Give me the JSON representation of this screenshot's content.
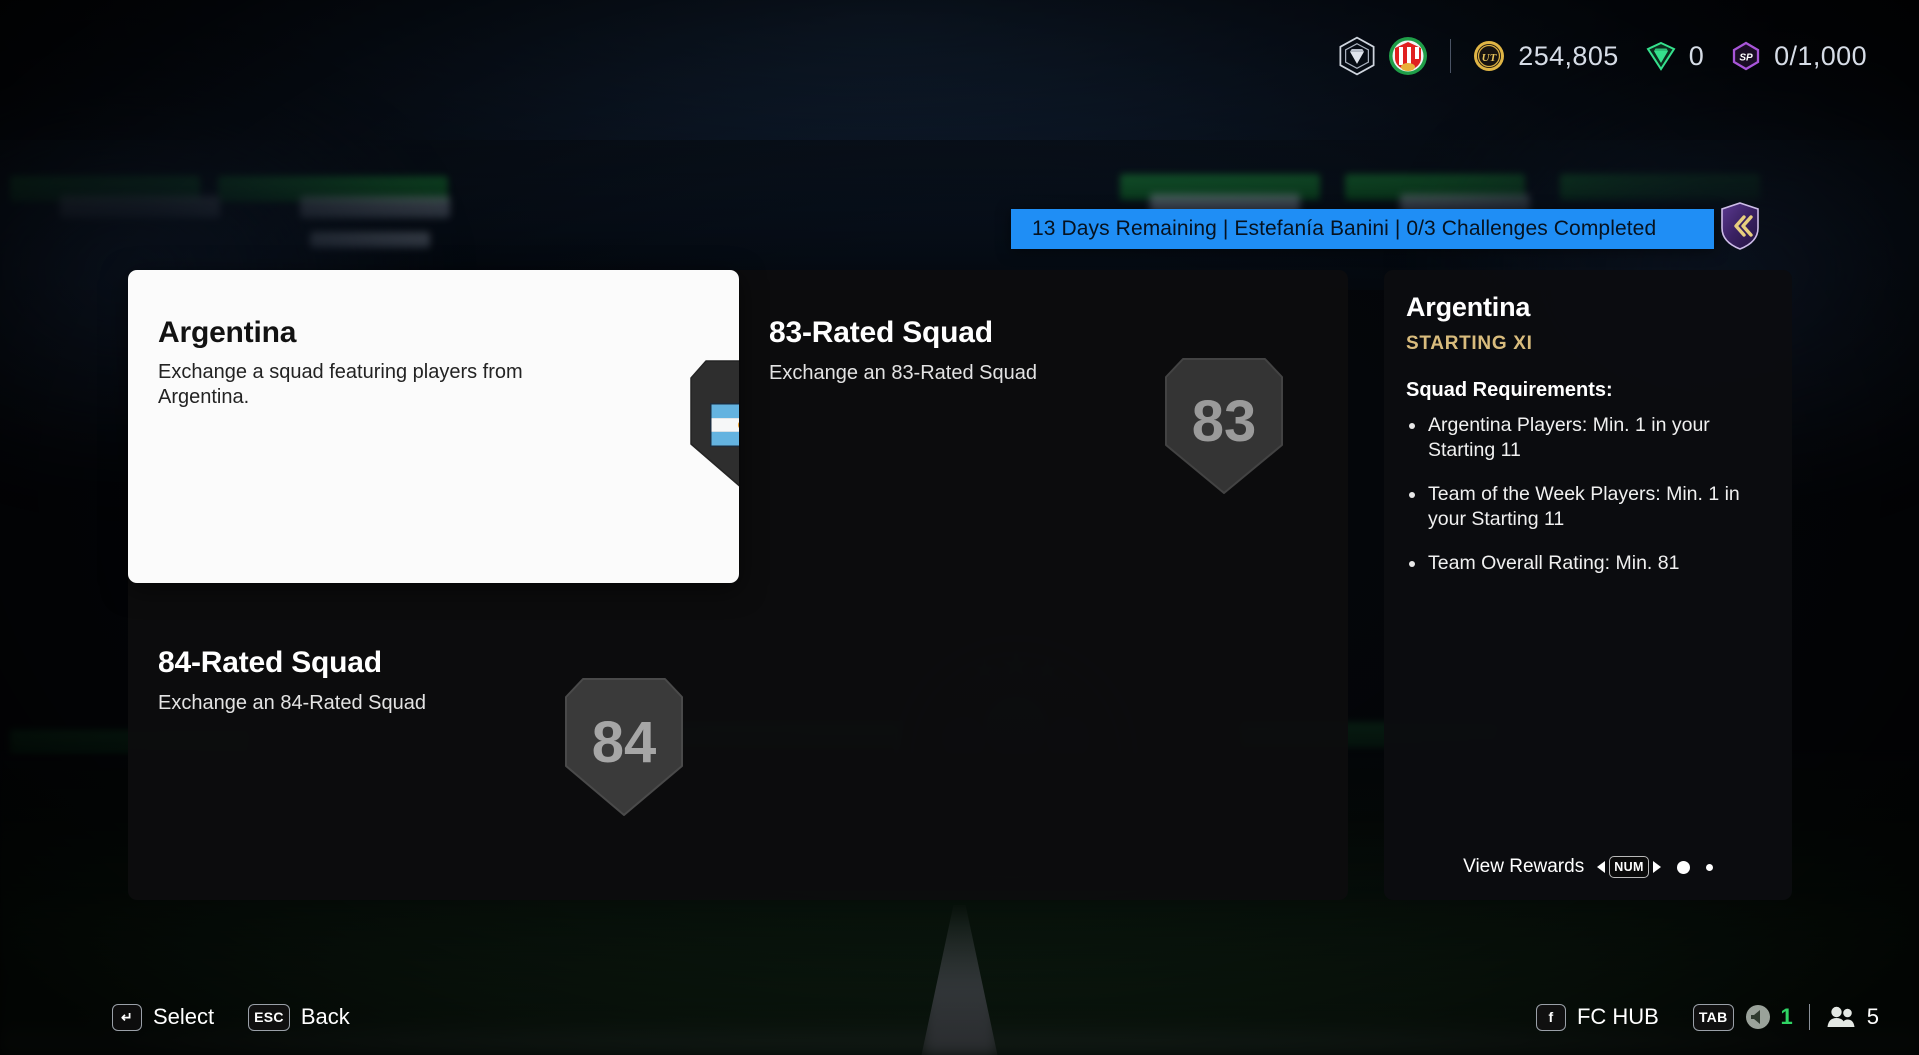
{
  "hud": {
    "crest_icon": "ultimate-team-crest-icon",
    "club_icon": "club-badge-icon",
    "coins": {
      "icon": "ut-coin-icon",
      "value": "254,805"
    },
    "points": {
      "icon": "fc-points-icon",
      "value": "0"
    },
    "season_points": {
      "icon": "sp-hex-icon",
      "value": "0/1,000"
    }
  },
  "banner": {
    "text": "13 Days Remaining | Estefanía Banini | 0/3 Challenges Completed",
    "collapse_icon": "double-chevron-left-icon",
    "color": "#1f8ef5"
  },
  "tiles": [
    {
      "title": "Argentina",
      "subtitle": "Exchange a squad featuring players from Argentina.",
      "badge_type": "flag",
      "badge_name": "argentina-flag-badge",
      "selected": true
    },
    {
      "title": "83-Rated Squad",
      "subtitle": "Exchange an 83-Rated Squad",
      "badge_type": "rating",
      "badge_name": "rating-83-badge",
      "rating": "83",
      "selected": false
    },
    {
      "title": "84-Rated Squad",
      "subtitle": "Exchange an 84-Rated Squad",
      "badge_type": "rating",
      "badge_name": "rating-84-badge",
      "rating": "84",
      "selected": false
    }
  ],
  "details": {
    "title": "Argentina",
    "subtitle": "STARTING XI",
    "subtitle_color": "#d9bc7d",
    "requirements_heading": "Squad Requirements:",
    "requirements": [
      "Argentina Players: Min. 1 in your Starting 11",
      "Team of the Week Players: Min. 1 in your Starting 11",
      "Team Overall Rating: Min. 81"
    ],
    "footer": {
      "label": "View Rewards",
      "key": "NUM",
      "page_current": 1,
      "page_total": 2
    }
  },
  "bottom_bar": {
    "left": [
      {
        "key": "↵",
        "label": "Select",
        "icon": "enter-key-icon"
      },
      {
        "key": "ESC",
        "label": "Back",
        "icon": "esc-key-icon"
      }
    ],
    "right": {
      "fc_hub_key": "f",
      "fc_hub_label": "FC HUB",
      "tab_key": "TAB",
      "voice_icon": "speaker-icon",
      "voice_count": "1",
      "voice_color": "#2fd464",
      "friends_icon": "people-icon",
      "friends_count": "5"
    }
  }
}
